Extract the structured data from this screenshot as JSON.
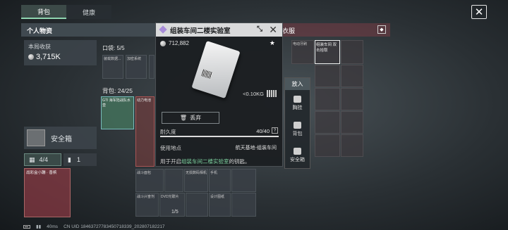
{
  "tabs": [
    {
      "label": "背包"
    },
    {
      "label": "健康"
    }
  ],
  "left": {
    "header": "个人物资",
    "earnings_label": "本局收获",
    "earnings_value": "3,715K",
    "pocket_label": "口袋: 5/5",
    "bag_label": "背包: 24/25",
    "safe_label": "安全箱",
    "count_a": "4/4",
    "count_b": "1",
    "gift_label": "战彩盒小蹦 · 香槟"
  },
  "pocket_items": [
    "装载数据...",
    "加密系统",
    "",
    ""
  ],
  "bag_items": [
    "GTI 海军陆战队水壶",
    "动力电池",
    "",
    "",
    "",
    "",
    "",
    "",
    "",
    "",
    "",
    "",
    "",
    "",
    "",
    "",
    "",
    "",
    "战斗面包",
    "无损数码相机",
    "手机",
    "",
    "战斗兴奋剂",
    "DVD光碟片",
    "",
    "设计图纸"
  ],
  "right": {
    "header": "衣服",
    "cells": [
      "电动牙刷",
      "组装车间 双击拾取",
      "",
      "",
      "",
      "",
      "",
      "",
      "",
      "",
      "",
      ""
    ]
  },
  "actions": {
    "title": "放入",
    "items": [
      "胸挂",
      "背包",
      "安全箱"
    ]
  },
  "popup": {
    "title": "组装车间二楼实验室",
    "price": "712,882",
    "weight": "<0.10KG",
    "discard": "丢弃",
    "durability_label": "耐久度",
    "durability_value": "40/40",
    "use_label": "使用地点",
    "use_value": "航天基地-组装车间",
    "desc_prefix": "用于开启",
    "desc_highlight": "组装车间二楼实验室",
    "desc_suffix": "的钥匙。"
  },
  "stack_count": "1/5",
  "footer": {
    "ping": "40ms",
    "uid": "CN UID 18463727783450718339_202807182217"
  }
}
